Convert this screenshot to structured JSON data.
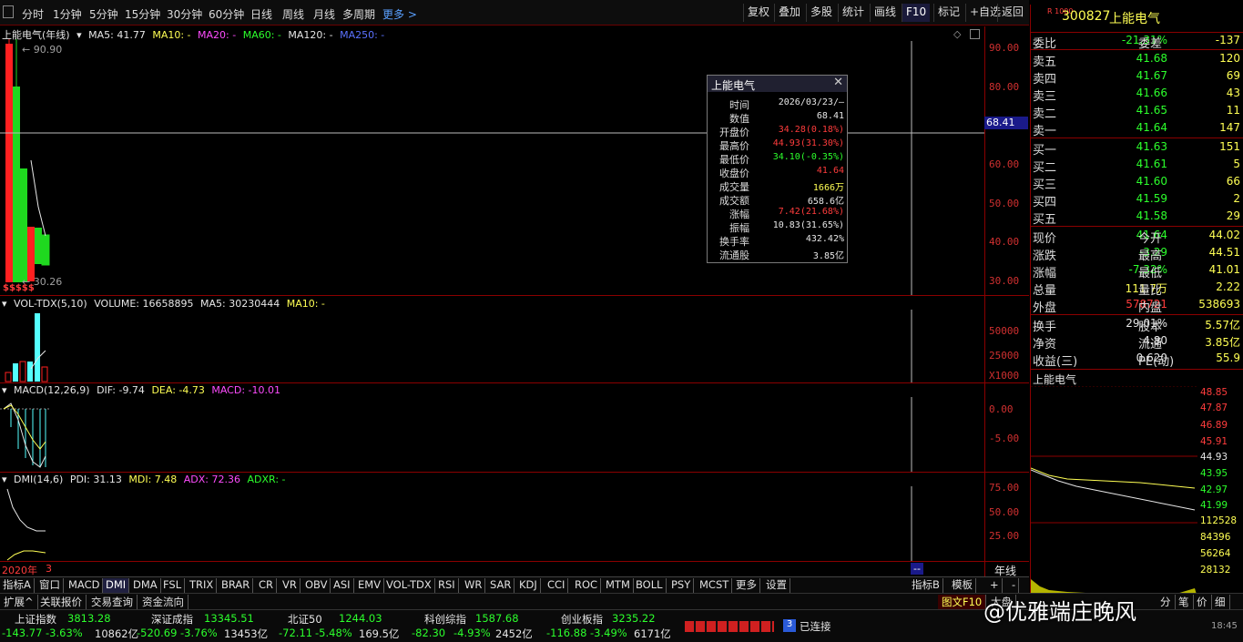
{
  "toolbar": {
    "periods": [
      "分时",
      "1分钟",
      "5分钟",
      "15分钟",
      "30分钟",
      "60分钟",
      "日线",
      "周线",
      "月线",
      "多周期"
    ],
    "more": "更多 >",
    "tools": [
      "复权",
      "叠加",
      "多股",
      "统计",
      "画线",
      "F10",
      "标记",
      "+自选",
      "返回"
    ]
  },
  "main_chart": {
    "title": "上能电气(年线)",
    "ma5": "MA5: 41.77",
    "ma10": "MA10: -",
    "ma20": "MA20: -",
    "ma60": "MA60: -",
    "ma120": "MA120: -",
    "ma250": "MA250: -",
    "high_label": "90.90",
    "low_label": "30.26",
    "y_ticks": [
      "90.00",
      "80.00",
      "70.00",
      "60.00",
      "50.00",
      "40.00",
      "30.00"
    ],
    "crosshair_value": "68.41",
    "markers": "$$$$$"
  },
  "volume_chart": {
    "title": "VOL-TDX(5,10)",
    "volume": "VOLUME: 16658895",
    "ma5": "MA5: 30230444",
    "ma10": "MA10: -",
    "y_ticks": [
      "50000",
      "25000"
    ],
    "unit": "X1000"
  },
  "macd_chart": {
    "title": "MACD(12,26,9)",
    "dif": "DIF: -9.74",
    "dea": "DEA: -4.73",
    "macd": "MACD: -10.01",
    "y_ticks": [
      "0.00",
      "-5.00"
    ]
  },
  "dmi_chart": {
    "title": "DMI(14,6)",
    "pdi": "PDI: 31.13",
    "mdi": "MDI: 7.48",
    "adx": "ADX: 72.36",
    "adxr": "ADXR: -",
    "y_ticks": [
      "75.00",
      "50.00",
      "25.00"
    ]
  },
  "x_axis": {
    "start": "2020年",
    "next": "3",
    "cursor": "--",
    "period": "年线"
  },
  "tooltip": {
    "title": "上能电气",
    "rows": [
      {
        "k": "时间",
        "v": "2026/03/23/—",
        "c": "white"
      },
      {
        "k": "数值",
        "v": "68.41",
        "c": "white"
      },
      {
        "k": "开盘价",
        "v": "34.28(0.18%)",
        "c": "red"
      },
      {
        "k": "最高价",
        "v": "44.93(31.30%)",
        "c": "red"
      },
      {
        "k": "最低价",
        "v": "34.10(-0.35%)",
        "c": "green"
      },
      {
        "k": "收盘价",
        "v": "41.64",
        "c": "red"
      },
      {
        "k": "成交量",
        "v": "1666万",
        "c": "yellow"
      },
      {
        "k": "成交额",
        "v": "658.6亿",
        "c": "white"
      },
      {
        "k": "涨幅",
        "v": "7.42(21.68%)",
        "c": "red"
      },
      {
        "k": "振幅",
        "v": "10.83(31.65%)",
        "c": "white"
      },
      {
        "k": "换手率",
        "v": "432.42%",
        "c": "white"
      },
      {
        "k": "流通股",
        "v": "3.85亿",
        "c": "white"
      }
    ]
  },
  "quote": {
    "badge": "R 1000",
    "code": "300827",
    "name": "上能电气",
    "weibi_label": "委比",
    "weibi": "-21.31%",
    "weicha_label": "委差",
    "weicha": "-137",
    "sells": [
      {
        "label": "卖五",
        "price": "41.68",
        "vol": "120"
      },
      {
        "label": "卖四",
        "price": "41.67",
        "vol": "69"
      },
      {
        "label": "卖三",
        "price": "41.66",
        "vol": "43"
      },
      {
        "label": "卖二",
        "price": "41.65",
        "vol": "11"
      },
      {
        "label": "卖一",
        "price": "41.64",
        "vol": "147"
      }
    ],
    "buys": [
      {
        "label": "买一",
        "price": "41.63",
        "vol": "151"
      },
      {
        "label": "买二",
        "price": "41.61",
        "vol": "5"
      },
      {
        "label": "买三",
        "price": "41.60",
        "vol": "66"
      },
      {
        "label": "买四",
        "price": "41.59",
        "vol": "2"
      },
      {
        "label": "买五",
        "price": "41.58",
        "vol": "29"
      }
    ],
    "stats": [
      {
        "l1": "现价",
        "v1": "41.64",
        "c1": "green",
        "l2": "今开",
        "v2": "44.02",
        "c2": "green"
      },
      {
        "l1": "涨跌",
        "v1": "-3.29",
        "c1": "green",
        "l2": "最高",
        "v2": "44.51",
        "c2": "green"
      },
      {
        "l1": "涨幅",
        "v1": "-7.32%",
        "c1": "green",
        "l2": "最低",
        "v2": "41.01",
        "c2": "green"
      },
      {
        "l1": "总量",
        "v1": "111.7万",
        "c1": "yellow",
        "l2": "量比",
        "v2": "2.22",
        "c2": "red"
      },
      {
        "l1": "外盘",
        "v1": "578721",
        "c1": "red",
        "l2": "内盘",
        "v2": "538693",
        "c2": "green"
      }
    ],
    "fundamentals": [
      {
        "l1": "换手",
        "v1": "29.01%",
        "l2": "股本",
        "v2": "5.57亿"
      },
      {
        "l1": "净资",
        "v1": "4.80",
        "l2": "流通",
        "v2": "3.85亿"
      },
      {
        "l1": "收益(三)",
        "v1": "0.620",
        "l2": "PE(动)",
        "v2": "55.9"
      }
    ],
    "mini_title": "上能电气",
    "mini_ticks": [
      "48.85",
      "47.87",
      "46.89",
      "45.91",
      "44.93",
      "43.95",
      "42.97",
      "41.99",
      "112528",
      "84396",
      "56264",
      "28132"
    ]
  },
  "indicator_tabs": [
    "指标A",
    "窗口",
    "MACD",
    "DMI",
    "DMA",
    "FSL",
    "TRIX",
    "BRAR",
    "CR",
    "VR",
    "OBV",
    "ASI",
    "EMV",
    "VOL-TDX",
    "RSI",
    "WR",
    "SAR",
    "KDJ",
    "CCI",
    "ROC",
    "MTM",
    "BOLL",
    "PSY",
    "MCST",
    "更多",
    "设置"
  ],
  "right_tabs": [
    "指标B",
    "模板",
    "+",
    "-"
  ],
  "bottom_tabs": [
    "扩展^",
    "关联报价",
    "交易查询",
    "资金流向"
  ],
  "right_bottom_tabs": [
    "图文F10",
    "大盘",
    "分",
    "笔",
    "价",
    "细"
  ],
  "indices": [
    {
      "name": "上证指数",
      "value": "3813.28",
      "chg": "-143.77",
      "pct": "-3.63%",
      "amt": "10862亿"
    },
    {
      "name": "深证成指",
      "value": "13345.51",
      "chg": "-520.69",
      "pct": "-3.76%",
      "amt": "13453亿"
    },
    {
      "name": "北证50",
      "value": "1244.03",
      "chg": "-72.11",
      "pct": "-5.48%",
      "amt": "169.5亿"
    },
    {
      "name": "科创综指",
      "value": "1587.68",
      "chg": "-82.30",
      "pct": "-4.93%",
      "amt": "2452亿"
    },
    {
      "name": "创业板指",
      "value": "3235.22",
      "chg": "-116.88",
      "pct": "-3.49%",
      "amt": "6171亿"
    }
  ],
  "connection": {
    "count": "3",
    "text": "已连接",
    "time": "18:45"
  },
  "watermark": "@优雅端庄晚风"
}
